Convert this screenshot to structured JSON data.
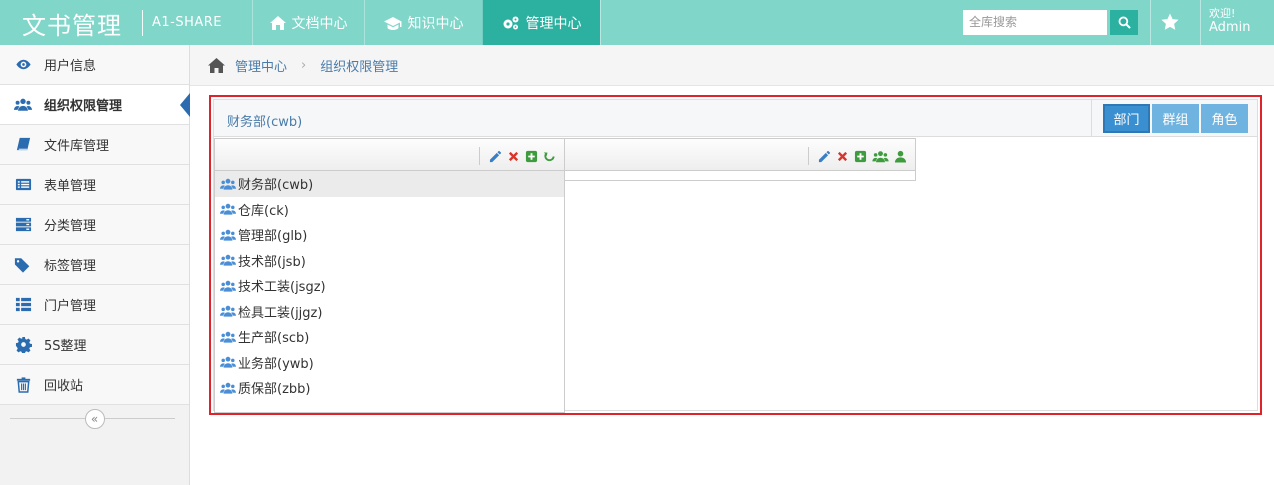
{
  "app": {
    "title": "文书管理",
    "subtitle": "A1-SHARE"
  },
  "nav": {
    "tabs": [
      {
        "label": "文档中心",
        "icon": "home-icon"
      },
      {
        "label": "知识中心",
        "icon": "graduation-cap-icon"
      },
      {
        "label": "管理中心",
        "icon": "cogs-icon",
        "active": true
      }
    ]
  },
  "search": {
    "placeholder": "全库搜索"
  },
  "user": {
    "greeting": "欢迎!",
    "name": "Admin"
  },
  "sidebar": {
    "items": [
      {
        "label": "用户信息",
        "icon": "eye-icon"
      },
      {
        "label": "组织权限管理",
        "icon": "users-icon",
        "active": true
      },
      {
        "label": "文件库管理",
        "icon": "book-icon"
      },
      {
        "label": "表单管理",
        "icon": "list-alt-icon"
      },
      {
        "label": "分类管理",
        "icon": "server-icon"
      },
      {
        "label": "标签管理",
        "icon": "tags-icon"
      },
      {
        "label": "门户管理",
        "icon": "list-icon"
      },
      {
        "label": "5S整理",
        "icon": "gear-icon"
      },
      {
        "label": "回收站",
        "icon": "trash-icon"
      }
    ],
    "collapse_glyph": "«"
  },
  "breadcrumb": {
    "items": [
      "管理中心",
      "组织权限管理"
    ],
    "separator": "›"
  },
  "panel": {
    "title": "财务部(cwb)",
    "buttons": [
      {
        "label": "部门",
        "active": true
      },
      {
        "label": "群组"
      },
      {
        "label": "角色"
      }
    ]
  },
  "tree": {
    "items": [
      {
        "label": "财务部(cwb)",
        "selected": true
      },
      {
        "label": "仓库(ck)"
      },
      {
        "label": "管理部(glb)"
      },
      {
        "label": "技术部(jsb)"
      },
      {
        "label": "技术工装(jsgz)"
      },
      {
        "label": "检具工装(jjgz)"
      },
      {
        "label": "生产部(scb)"
      },
      {
        "label": "业务部(ywb)"
      },
      {
        "label": "质保部(zbb)"
      }
    ]
  },
  "colors": {
    "topbar": "#7fd6c9",
    "active_tab": "#2cb1a1",
    "highlight_border": "#e0232b",
    "button": "#6fb3e0",
    "icon_blue": "#2b6cb0",
    "edit": "#3a7fc4",
    "delete": "#d9352b",
    "add": "#3e9b3e"
  }
}
